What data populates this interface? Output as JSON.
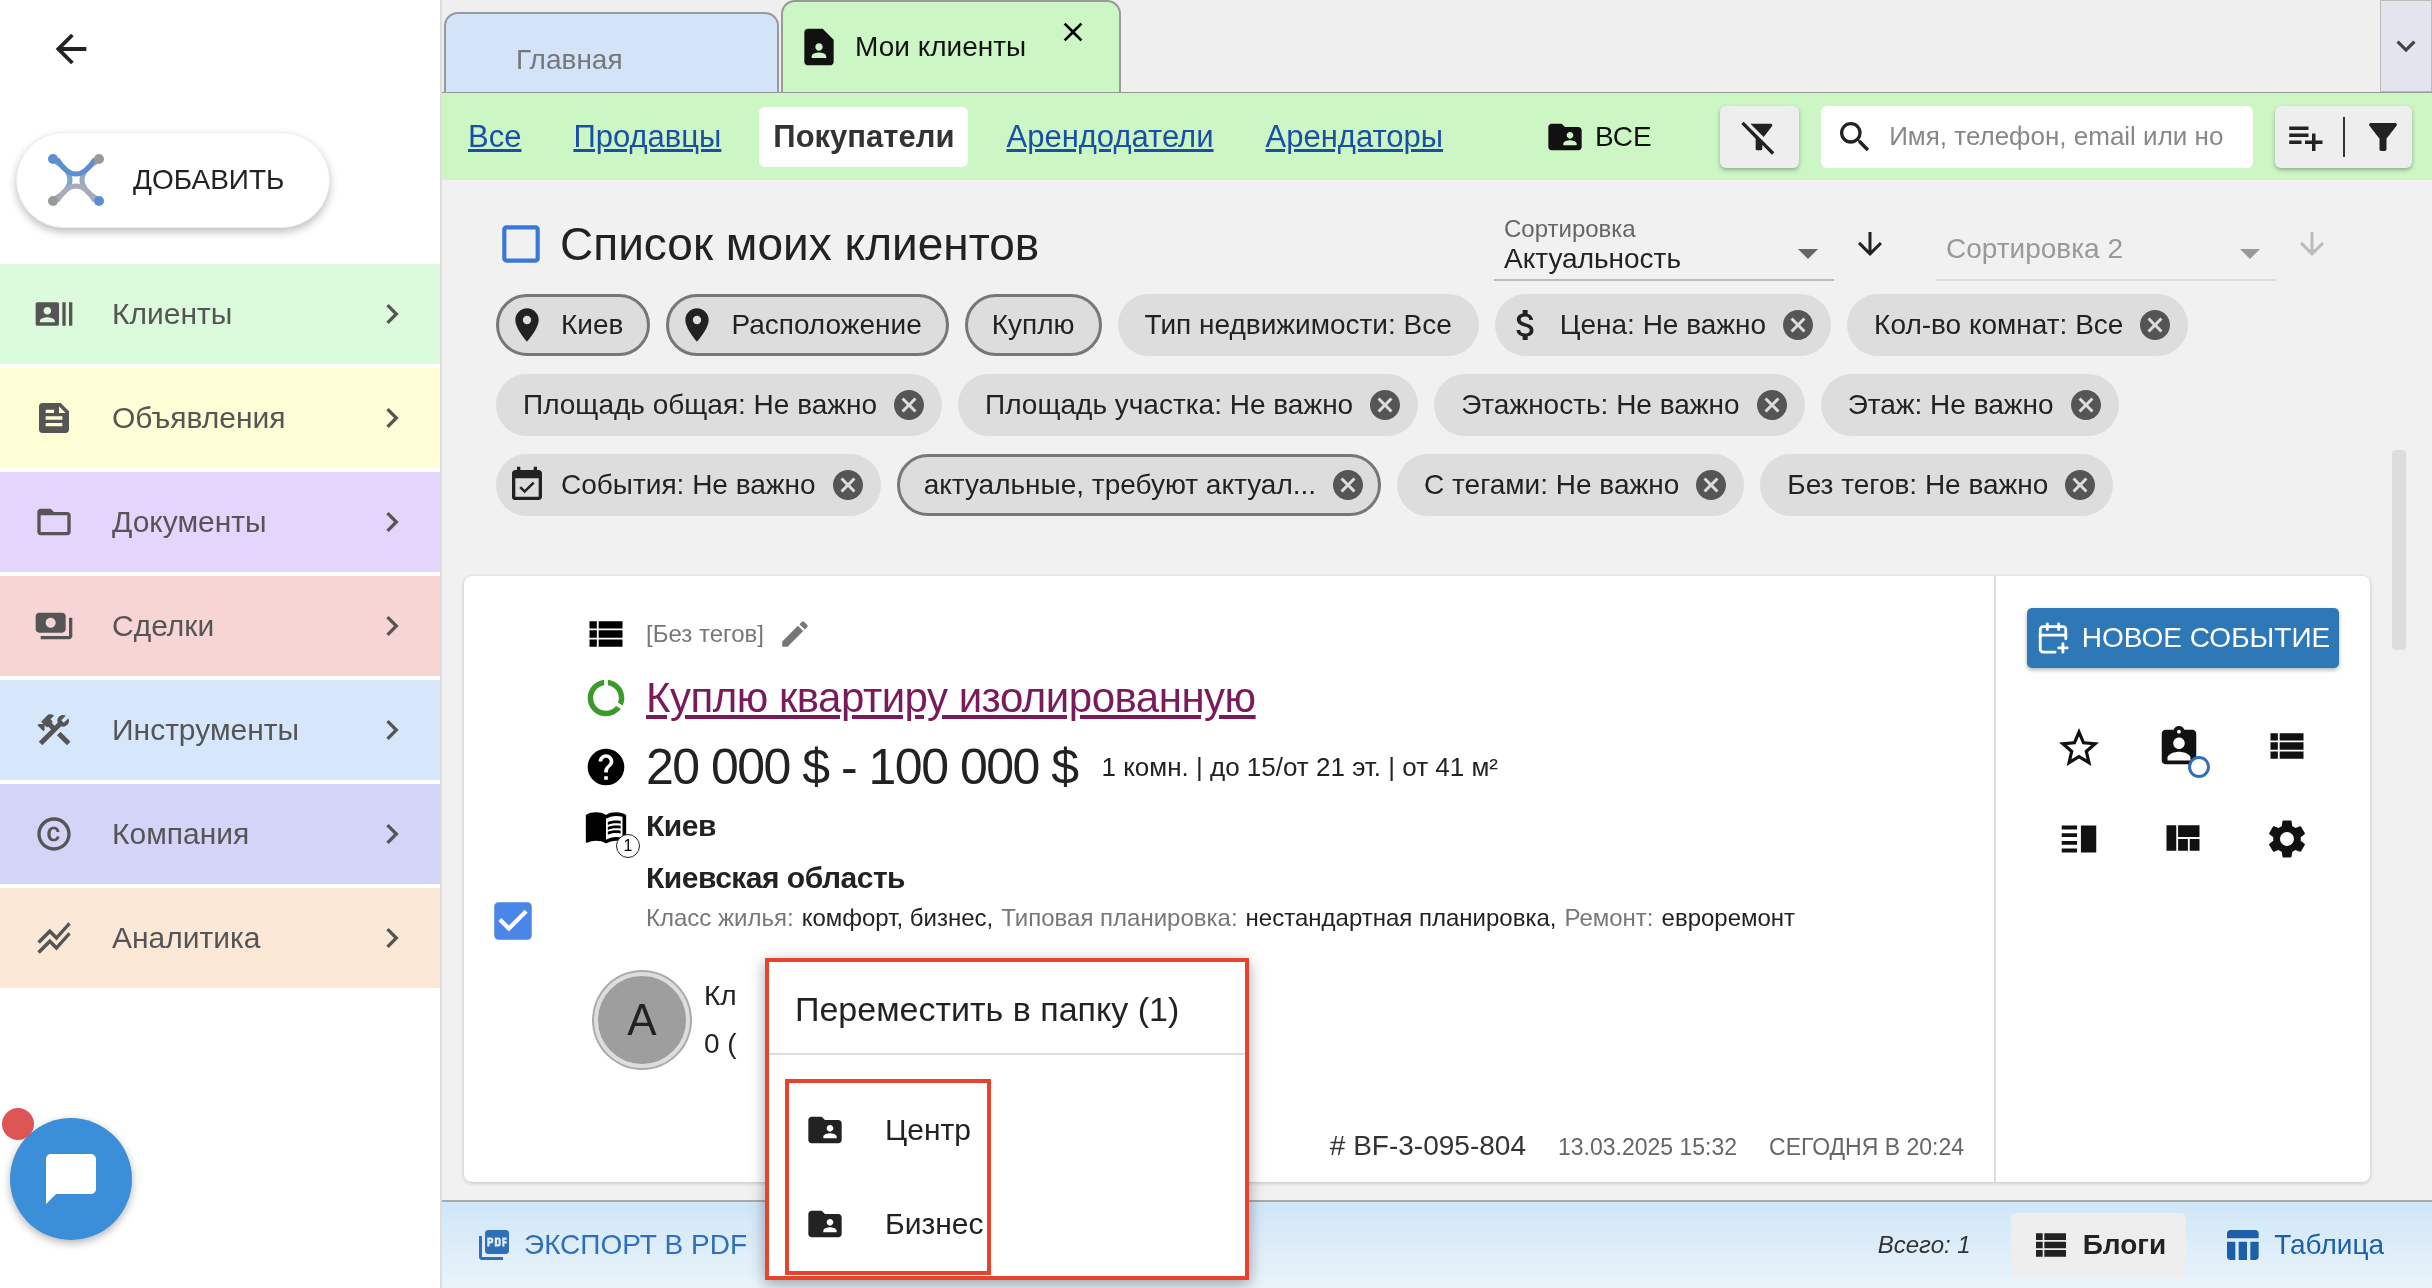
{
  "sidebar": {
    "add_button": "ДОБАВИТЬ",
    "items": [
      {
        "kind": "clients",
        "label": "Клиенты",
        "color": "#dcfadc"
      },
      {
        "kind": "ads",
        "label": "Объявления",
        "color": "#fdfdd6"
      },
      {
        "kind": "documents",
        "label": "Документы",
        "color": "#e3d5fb"
      },
      {
        "kind": "deals",
        "label": "Сделки",
        "color": "#f8d5d5"
      },
      {
        "kind": "tools",
        "label": "Инструменты",
        "color": "#d7e7fb"
      },
      {
        "kind": "company",
        "label": "Компания",
        "color": "#d4d4f8"
      },
      {
        "kind": "analytics",
        "label": "Аналитика",
        "color": "#fbe8d7"
      }
    ],
    "chat": {
      "unread": true
    }
  },
  "tabs": [
    {
      "label": "Главная",
      "selected": false,
      "closable": false
    },
    {
      "label": "Мои клиенты",
      "selected": true,
      "closable": true
    }
  ],
  "filter_bar": {
    "links": [
      {
        "label": "Все",
        "selected": false
      },
      {
        "label": "Продавцы",
        "selected": false
      },
      {
        "label": "Покупатели",
        "selected": true
      },
      {
        "label": "Арендодатели",
        "selected": false
      },
      {
        "label": "Арендаторы",
        "selected": false
      }
    ],
    "folder_button": "ВСЕ",
    "search": {
      "placeholder": "Имя, телефон, email или но"
    }
  },
  "list_header": {
    "title": "Список моих клиентов",
    "checked": false,
    "sorts": [
      {
        "label": "Сортировка",
        "value": "Актуальность",
        "disabled": false
      },
      {
        "label": "Сортировка 2",
        "disabled": true
      }
    ]
  },
  "chips": [
    {
      "kind": "location",
      "label": "Киев",
      "outlined": true,
      "removable": false
    },
    {
      "kind": "location",
      "label": "Расположение",
      "outlined": true,
      "removable": false
    },
    {
      "kind": "plain",
      "label": "Куплю",
      "outlined": true,
      "removable": false
    },
    {
      "kind": "plain",
      "label": "Тип недвижимости: Все",
      "outlined": false,
      "removable": false
    },
    {
      "kind": "price",
      "label": "Цена: Не важно",
      "outlined": false,
      "removable": true
    },
    {
      "kind": "plain",
      "label": "Кол-во комнат: Все",
      "outlined": false,
      "removable": true
    },
    {
      "kind": "plain",
      "label": "Площадь общая: Не важно",
      "outlined": false,
      "removable": true
    },
    {
      "kind": "plain",
      "label": "Площадь участка: Не важно",
      "outlined": false,
      "removable": true
    },
    {
      "kind": "plain",
      "label": "Этажность: Не важно",
      "outlined": false,
      "removable": true
    },
    {
      "kind": "plain",
      "label": "Этаж: Не важно",
      "outlined": false,
      "removable": true
    },
    {
      "kind": "events",
      "label": "События: Не важно",
      "outlined": false,
      "removable": true
    },
    {
      "kind": "plain",
      "label": "актуальные, требуют актуал...",
      "outlined": true,
      "removable": true
    },
    {
      "kind": "plain",
      "label": "С тегами: Не важно",
      "outlined": false,
      "removable": true
    },
    {
      "kind": "plain",
      "label": "Без тегов: Не важно",
      "outlined": false,
      "removable": true
    }
  ],
  "card": {
    "checked": true,
    "tags": "[Без тегов]",
    "title": "Куплю квартиру изолированную",
    "price": "20 000 $ - 100 000 $",
    "details": "1 комн. | до 15/от 21 эт. | от 41 м²",
    "locations_badge": "1",
    "city": "Киев",
    "region": "Киевская область",
    "attributes": [
      {
        "label": "Класс жилья:",
        "value": "комфорт, бизнес,"
      },
      {
        "label": "Типовая планировка:",
        "value": "нестандартная планировка,"
      },
      {
        "label": "Ремонт:",
        "value": "евроремонт"
      }
    ],
    "avatar": "A",
    "client_name": "Кл",
    "client_info": "0 (",
    "id": "# BF-3-095-804",
    "created": "13.03.2025 15:32",
    "updated": "СЕГОДНЯ В 20:24",
    "new_event_button": "НОВОЕ СОБЫТИЕ"
  },
  "folder_menu": {
    "title": "Переместить в папку (1)",
    "items": [
      {
        "label": "Центр"
      },
      {
        "label": "Бизнес"
      }
    ]
  },
  "bottom_bar": {
    "export_button": "ЭКСПОРТ В PDF",
    "total": "Всего: 1",
    "views": [
      {
        "kind": "blogs",
        "label": "Блоги",
        "selected": true
      },
      {
        "kind": "table",
        "label": "Таблица",
        "selected": false
      }
    ]
  }
}
